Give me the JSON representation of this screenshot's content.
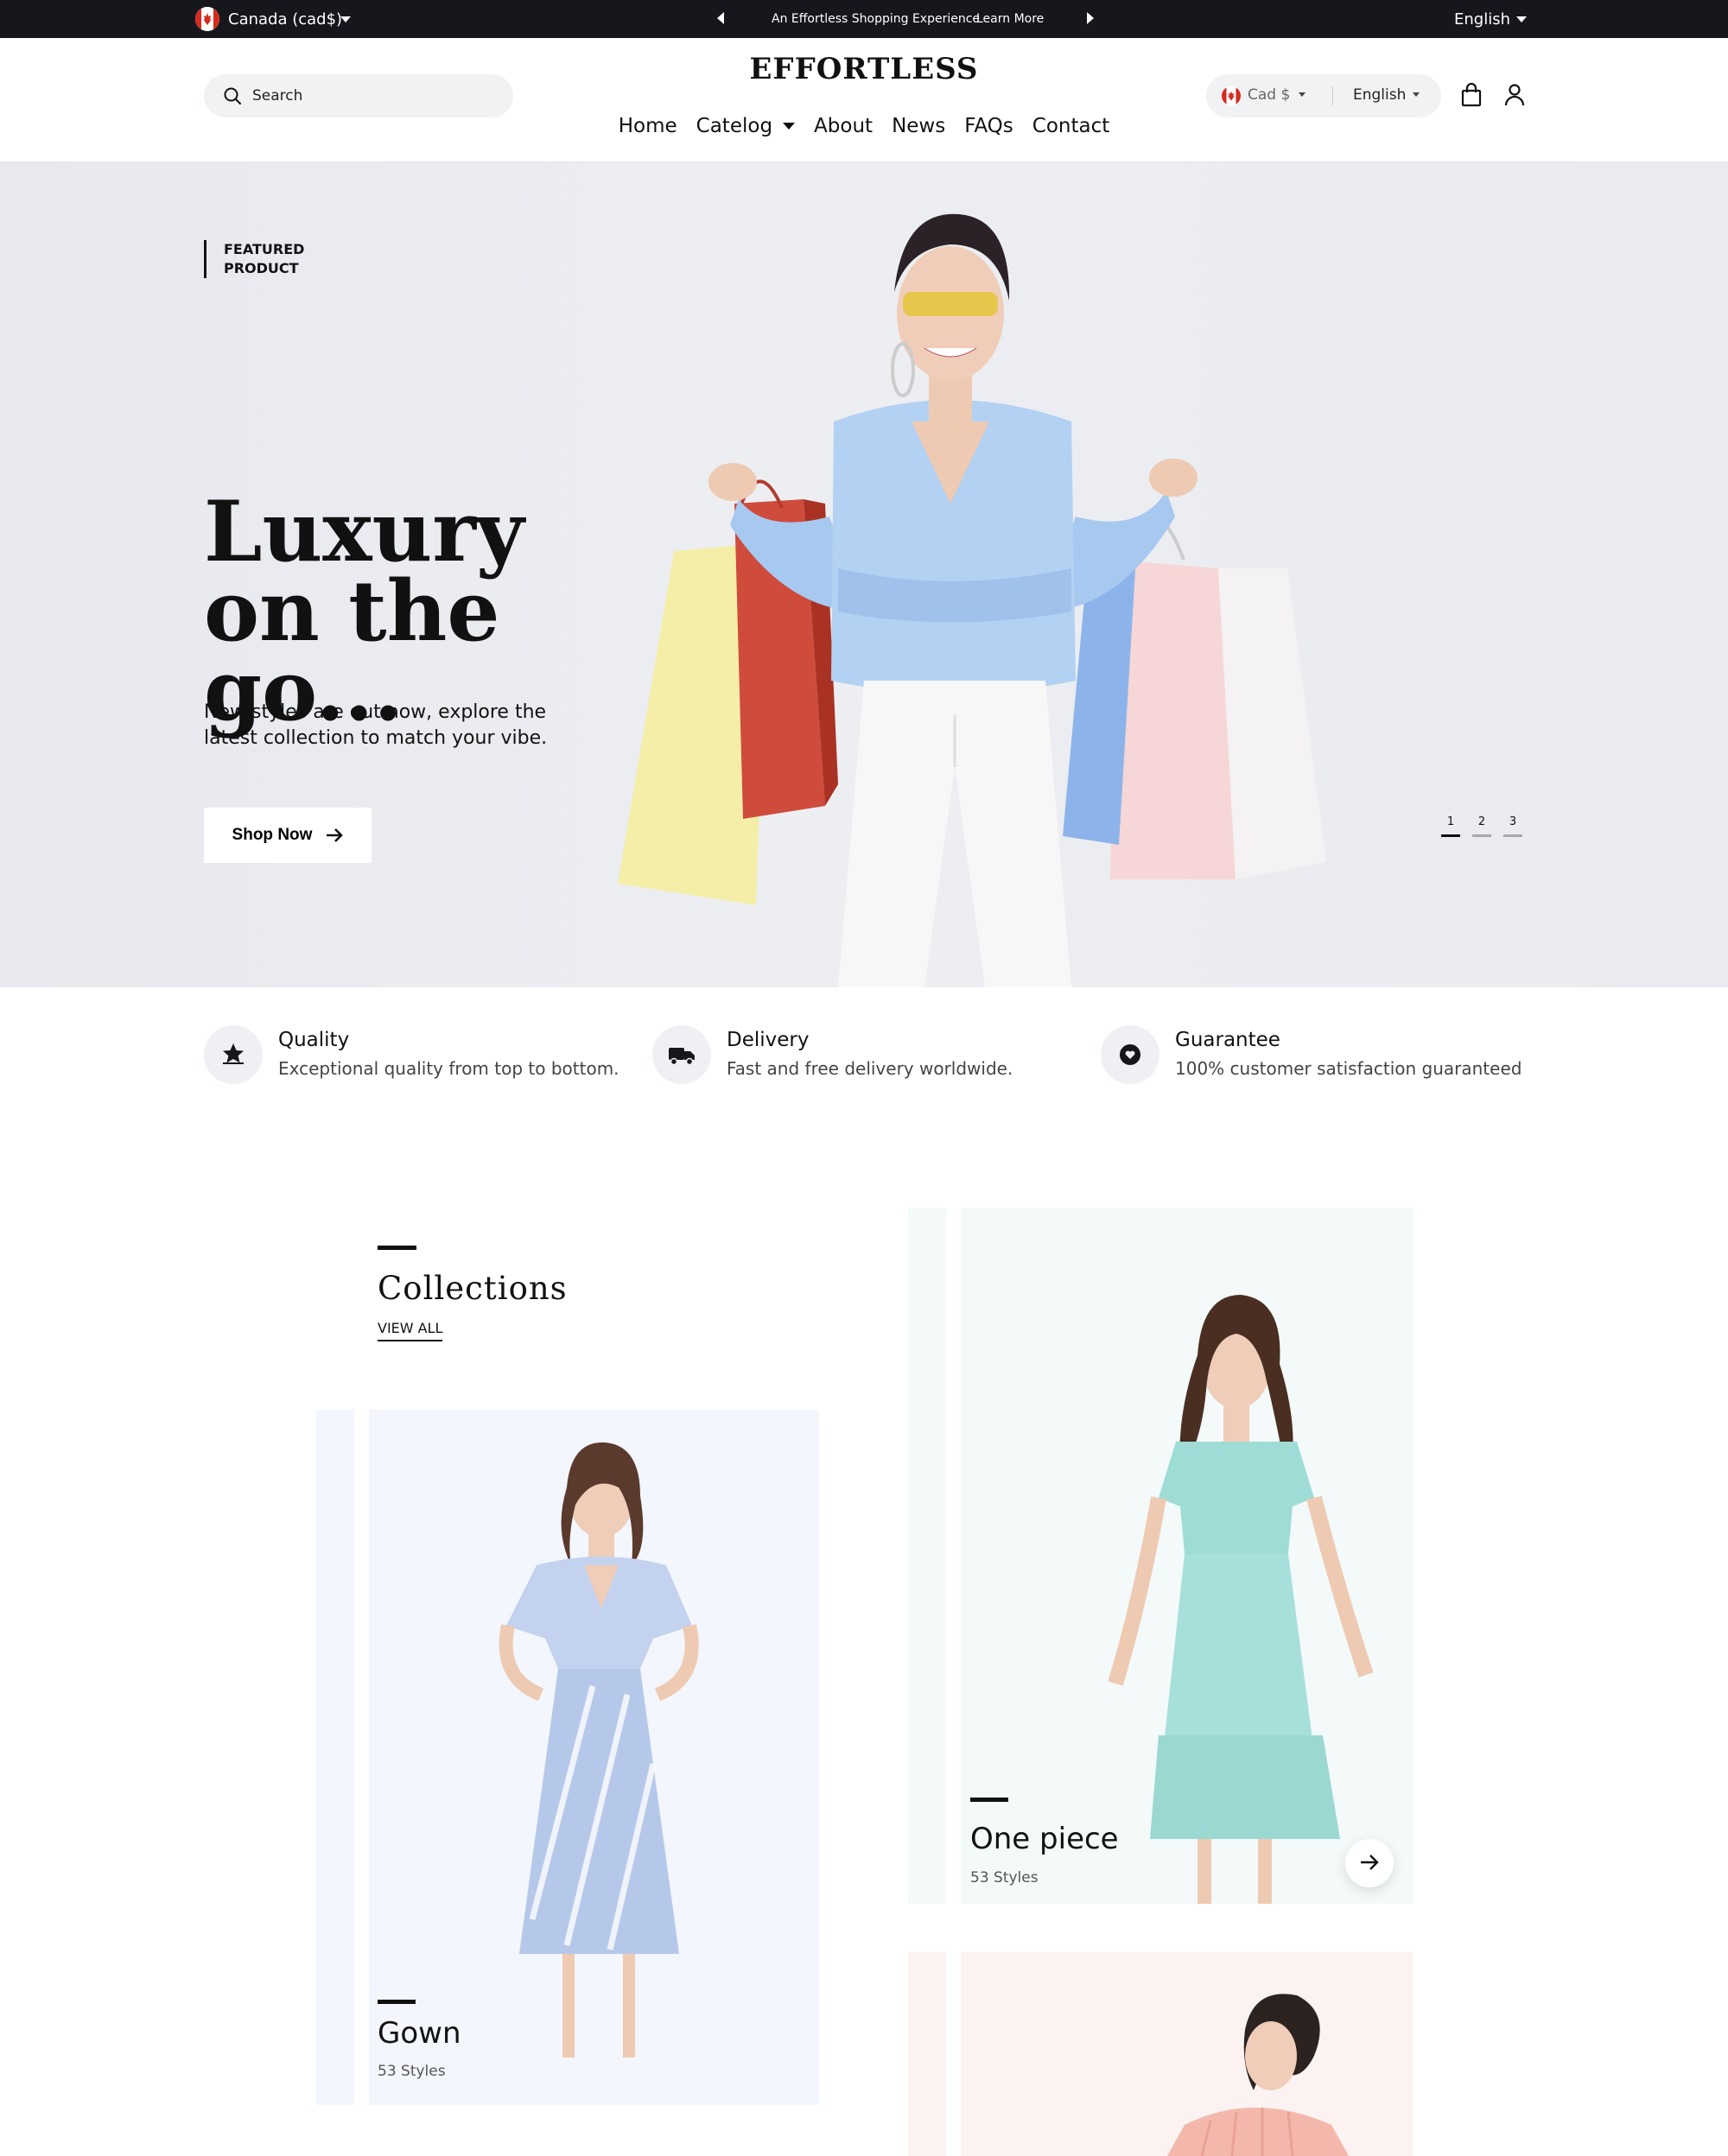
{
  "topbar": {
    "country": "Canada (cad$)",
    "announcement": "An Effortless Shopping Experience",
    "learn_more": "Learn More",
    "language": "English"
  },
  "header": {
    "search_placeholder": "Search",
    "logo": "EFFORTLESS",
    "nav": [
      "Home",
      "Catelog",
      "About",
      "News",
      "FAQs",
      "Contact"
    ],
    "currency": "Cad $",
    "language": "English"
  },
  "hero": {
    "featured": [
      "FEATURED",
      "PRODUCT"
    ],
    "headline": [
      "Luxury",
      "on the go..."
    ],
    "subtitle": "New styles are out now, explore the latest collection to match your vibe.",
    "cta": "Shop Now",
    "slides": [
      "1",
      "2",
      "3"
    ],
    "active_slide": 1
  },
  "features": [
    {
      "title": "Quality",
      "desc": "Exceptional quality from top to bottom.",
      "icon": "star-badge-icon"
    },
    {
      "title": "Delivery",
      "desc": "Fast and free delivery worldwide.",
      "icon": "truck-icon"
    },
    {
      "title": "Guarantee",
      "desc": "100% customer satisfaction guaranteed",
      "icon": "heart-shield-icon"
    }
  ],
  "collections": {
    "title": "Collections",
    "view_all": "VIEW ALL",
    "items": [
      {
        "name": "Gown",
        "styles": "53 Styles"
      },
      {
        "name": "One piece",
        "styles": "53 Styles"
      }
    ]
  },
  "colors": {
    "topbar_bg": "#15171c",
    "hero_bg": "#e9ebf0",
    "gown_bg": "#f3f6fc",
    "onepiece_bg": "#f3faf9",
    "third_bg": "#fcf2f1",
    "accent": "#111111"
  }
}
